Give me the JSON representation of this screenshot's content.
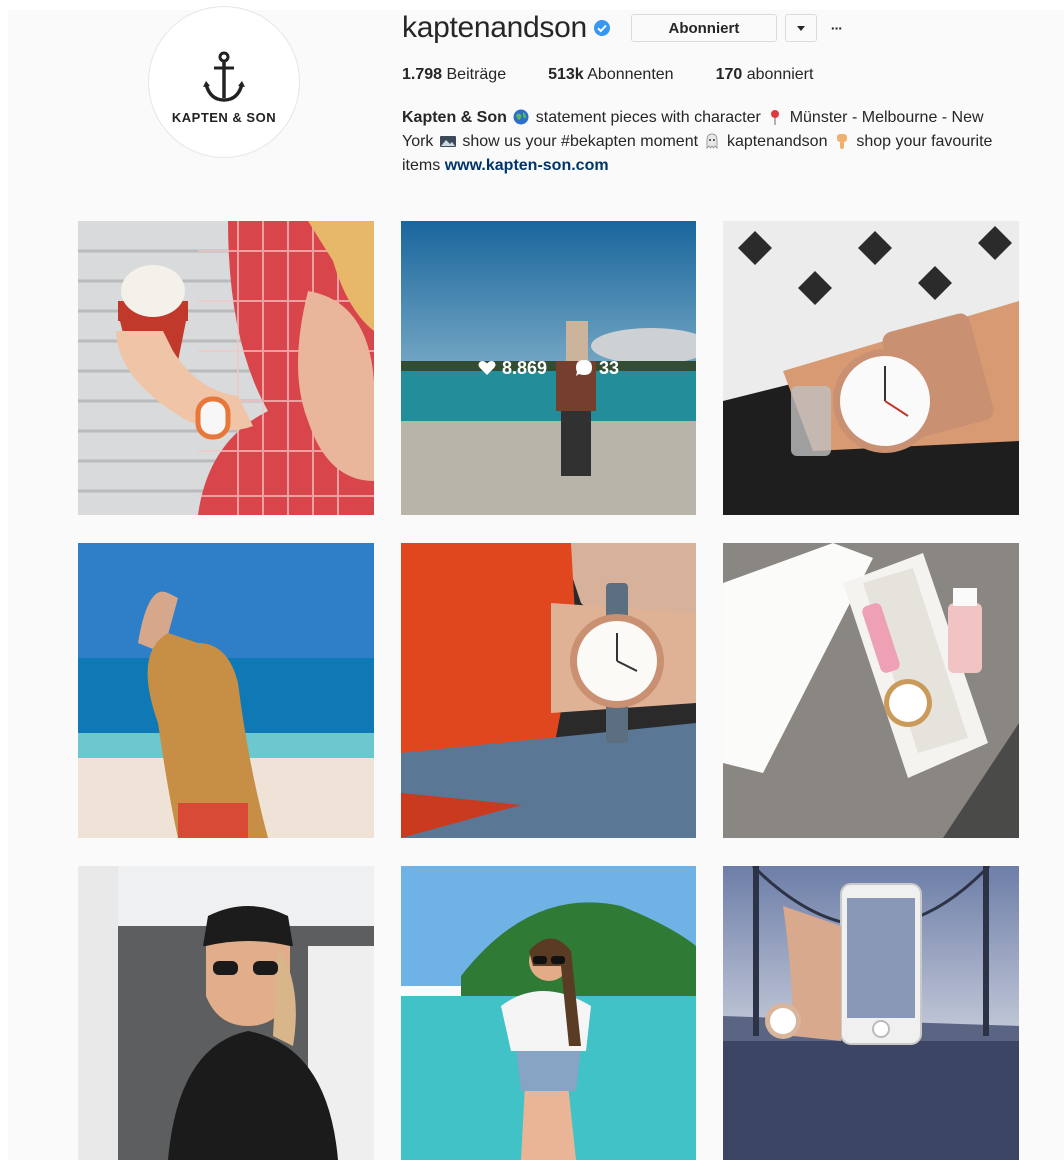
{
  "profile": {
    "avatar_text": "KAPTEN & SON",
    "username": "kaptenandson",
    "subscribe_label": "Abonniert",
    "more_label": "···",
    "stats": {
      "posts_count": "1.798",
      "posts_label": "Beiträge",
      "followers_count": "513k",
      "followers_label": "Abonnenten",
      "following_count": "170",
      "following_label": "abonniert"
    },
    "bio": {
      "name": "Kapten & Son",
      "t1": "statement pieces with character",
      "t2": "Münster -",
      "t3": "Melbourne - New York",
      "t4": "show us your #bekapten moment",
      "t5": "kaptenandson",
      "t6": "shop your favourite items",
      "link": "www.kapten-son.com"
    }
  },
  "grid": {
    "hover_post": {
      "likes": "8.869",
      "comments": "33"
    },
    "posts": [
      {
        "name": "post-icecream-watch"
      },
      {
        "name": "post-beach-piggyback"
      },
      {
        "name": "post-marble-watch"
      },
      {
        "name": "post-ocean-wave"
      },
      {
        "name": "post-red-sweater-watch"
      },
      {
        "name": "post-gift-box"
      },
      {
        "name": "post-beanie-man"
      },
      {
        "name": "post-bikini-beach"
      },
      {
        "name": "post-phone-bridge"
      }
    ]
  },
  "colors": {
    "link": "#003569",
    "verified": "#3897f0",
    "text": "#262626",
    "border": "#dbdbdb"
  },
  "icons": [
    "anchor-icon",
    "verified-badge-icon",
    "globe-icon",
    "pin-icon",
    "photo-icon",
    "ghost-icon",
    "pointing-hand-icon",
    "heart-icon",
    "comment-icon",
    "caret-down-icon"
  ]
}
